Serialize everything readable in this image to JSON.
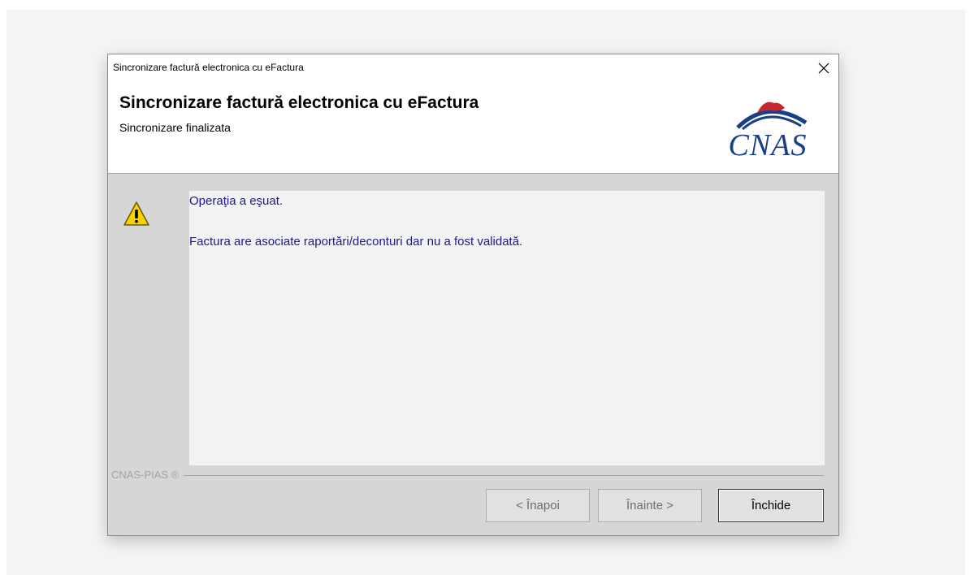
{
  "window": {
    "title": "Sincronizare factură electronica cu eFactura"
  },
  "header": {
    "title": "Sincronizare factură electronica cu eFactura",
    "subtitle": "Sincronizare finalizata",
    "logo_text": "CNAS"
  },
  "message": {
    "icon": "warning-icon",
    "line1": "Operaţia a eşuat.",
    "line2": "Factura are asociate raportări/deconturi dar nu a fost validată."
  },
  "footer": {
    "brand": "CNAS-PIAS ®"
  },
  "buttons": {
    "back": "< Înapoi",
    "next": "Înainte >",
    "close": "Închide"
  },
  "colors": {
    "message_text": "#1a1a8c",
    "logo_blue": "#1a3f86",
    "logo_red": "#c8262e",
    "dialog_bg": "#d6d6d6"
  }
}
